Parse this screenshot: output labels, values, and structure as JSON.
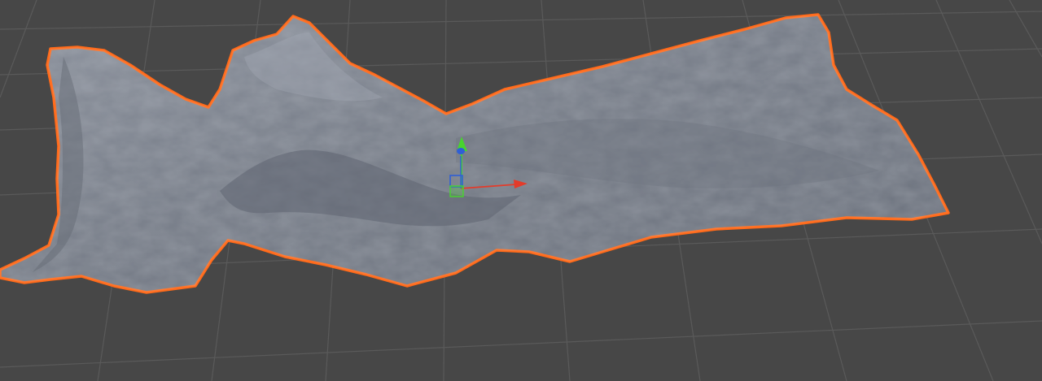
{
  "scene": {
    "background_color": "#474747",
    "grid_color": "#5a5a5a",
    "object": {
      "kind": "terrain-mesh",
      "surface_color": "#7b818c",
      "selected": true,
      "outline_color": "#ff6a1a"
    },
    "gizmo": {
      "type": "move",
      "axes": [
        {
          "axis": "x",
          "color": "#e43b2a"
        },
        {
          "axis": "y",
          "color": "#48d42e"
        },
        {
          "axis": "z",
          "color": "#2f5fd6"
        }
      ]
    }
  }
}
